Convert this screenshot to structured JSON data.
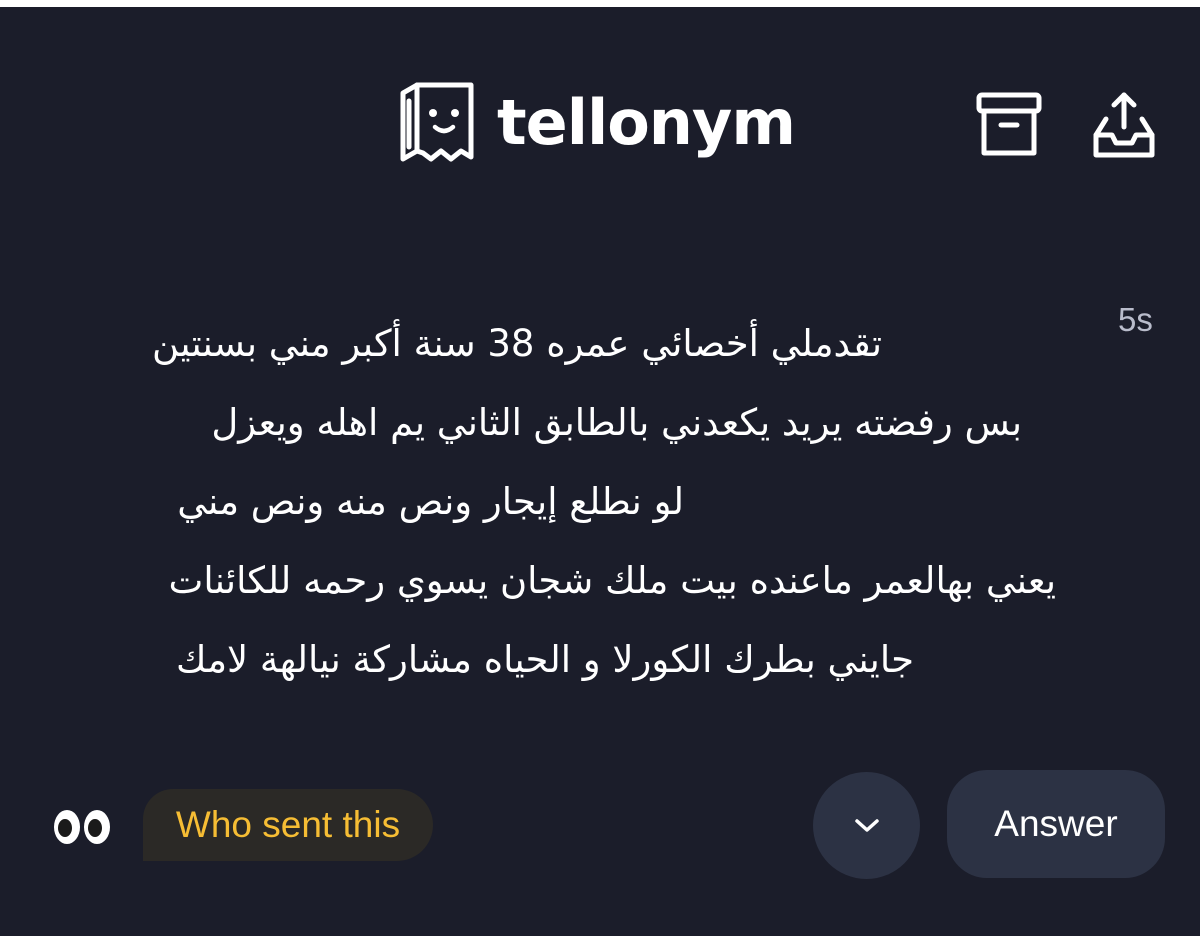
{
  "header": {
    "app_name": "tellonym",
    "logo_icon": "paper-bag-face-icon",
    "archive_icon": "archive-box-icon",
    "share_icon": "share-upload-icon"
  },
  "tell": {
    "time": "5s",
    "lines": [
      "تقدملي أخصائي عمره 38 سنة أكبر مني بسنتين",
      "بس رفضته يريد يكعدني بالطابق الثاني يم اهله ويعزل",
      "لو نطلع إيجار ونص منه ونص مني",
      "يعني بهالعمر ماعنده بيت ملك شجان يسوي رحمه للكائنات",
      "جايني بطرك الكورلا و الحياه مشاركة نيالهة لامك"
    ]
  },
  "footer": {
    "eyes_icon": "eyes-emoji-icon",
    "who_sent_label": "Who sent this",
    "expand_icon": "chevron-down-icon",
    "answer_label": "Answer"
  },
  "colors": {
    "background": "#1b1d2a",
    "text": "#ffffff",
    "who_sent_text": "#f6bd34",
    "who_sent_bg": "#2b2926",
    "button_bg": "#2c3244",
    "time_text": "#b9bccb"
  }
}
